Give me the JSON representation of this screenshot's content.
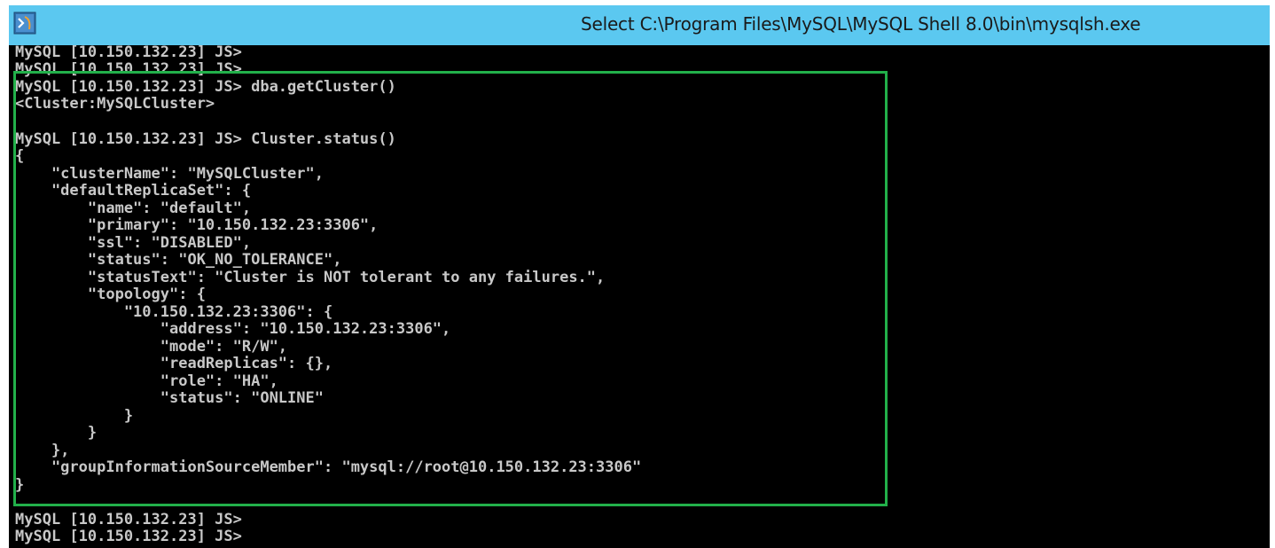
{
  "window": {
    "title": "Select C:\\Program Files\\MySQL\\MySQL Shell 8.0\\bin\\mysqlsh.exe",
    "icon": "mysql-shell-app-icon"
  },
  "console": {
    "lines": [
      "MySQL [10.150.132.23] JS>",
      "MySQL [10.150.132.23] JS>",
      "MySQL [10.150.132.23] JS> dba.getCluster()",
      "<Cluster:MySQLCluster>",
      "",
      "MySQL [10.150.132.23] JS> Cluster.status()",
      "{",
      "    \"clusterName\": \"MySQLCluster\",",
      "    \"defaultReplicaSet\": {",
      "        \"name\": \"default\",",
      "        \"primary\": \"10.150.132.23:3306\",",
      "        \"ssl\": \"DISABLED\",",
      "        \"status\": \"OK_NO_TOLERANCE\",",
      "        \"statusText\": \"Cluster is NOT tolerant to any failures.\",",
      "        \"topology\": {",
      "            \"10.150.132.23:3306\": {",
      "                \"address\": \"10.150.132.23:3306\",",
      "                \"mode\": \"R/W\",",
      "                \"readReplicas\": {},",
      "                \"role\": \"HA\",",
      "                \"status\": \"ONLINE\"",
      "            }",
      "        }",
      "    },",
      "    \"groupInformationSourceMember\": \"mysql://root@10.150.132.23:3306\"",
      "}",
      "",
      "MySQL [10.150.132.23] JS>",
      "MySQL [10.150.132.23] JS>"
    ]
  },
  "colors": {
    "titlebar": "#5bc8f0",
    "console_bg": "#000000",
    "console_text": "#c8c8c8",
    "highlight": "#22b04a"
  }
}
